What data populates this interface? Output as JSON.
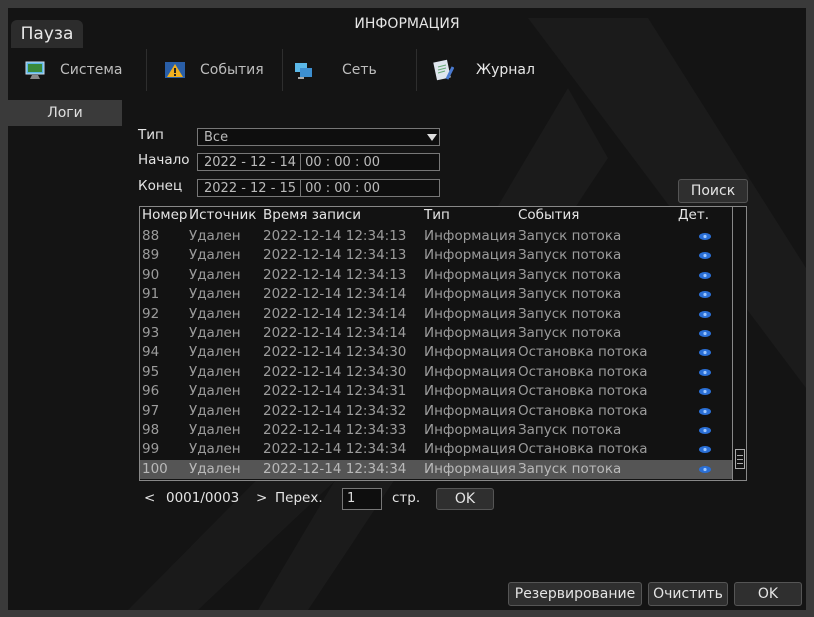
{
  "window": {
    "title": "ИНФОРМАЦИЯ",
    "pause_label": "Пауза"
  },
  "tabs": [
    {
      "label": "Система",
      "icon": "monitor-icon"
    },
    {
      "label": "События",
      "icon": "warning-icon"
    },
    {
      "label": "Сеть",
      "icon": "network-icon"
    },
    {
      "label": "Журнал",
      "icon": "log-icon"
    }
  ],
  "sidebar": {
    "items": [
      {
        "label": "Логи"
      }
    ]
  },
  "filters": {
    "type_label": "Тип",
    "type_value": "Все",
    "start_label": "Начало",
    "start_date": "2022  - 12 - 14",
    "start_time": "00 : 00 : 00",
    "end_label": "Конец",
    "end_date": "2022  - 12 - 15",
    "end_time": "00 : 00 : 00",
    "search_label": "Поиск"
  },
  "table": {
    "headers": {
      "num": "Номер",
      "source": "Источник",
      "time": "Время записи",
      "type": "Тип",
      "event": "События",
      "details": "Дет."
    },
    "rows": [
      {
        "num": "88",
        "source": "Удален",
        "time": "2022-12-14 12:34:13",
        "type": "Информация",
        "event": "Запуск потока"
      },
      {
        "num": "89",
        "source": "Удален",
        "time": "2022-12-14 12:34:13",
        "type": "Информация",
        "event": "Запуск потока"
      },
      {
        "num": "90",
        "source": "Удален",
        "time": "2022-12-14 12:34:13",
        "type": "Информация",
        "event": "Запуск потока"
      },
      {
        "num": "91",
        "source": "Удален",
        "time": "2022-12-14 12:34:14",
        "type": "Информация",
        "event": "Запуск потока"
      },
      {
        "num": "92",
        "source": "Удален",
        "time": "2022-12-14 12:34:14",
        "type": "Информация",
        "event": "Запуск потока"
      },
      {
        "num": "93",
        "source": "Удален",
        "time": "2022-12-14 12:34:14",
        "type": "Информация",
        "event": "Запуск потока"
      },
      {
        "num": "94",
        "source": "Удален",
        "time": "2022-12-14 12:34:30",
        "type": "Информация",
        "event": "Остановка потока"
      },
      {
        "num": "95",
        "source": "Удален",
        "time": "2022-12-14 12:34:30",
        "type": "Информация",
        "event": "Остановка потока"
      },
      {
        "num": "96",
        "source": "Удален",
        "time": "2022-12-14 12:34:31",
        "type": "Информация",
        "event": "Остановка потока"
      },
      {
        "num": "97",
        "source": "Удален",
        "time": "2022-12-14 12:34:32",
        "type": "Информация",
        "event": "Остановка потока"
      },
      {
        "num": "98",
        "source": "Удален",
        "time": "2022-12-14 12:34:33",
        "type": "Информация",
        "event": "Запуск потока"
      },
      {
        "num": "99",
        "source": "Удален",
        "time": "2022-12-14 12:34:34",
        "type": "Информация",
        "event": "Остановка потока"
      },
      {
        "num": "100",
        "source": "Удален",
        "time": "2022-12-14 12:34:34",
        "type": "Информация",
        "event": "Запуск потока"
      }
    ]
  },
  "pager": {
    "prev": "<",
    "page": "0001/0003",
    "next": ">",
    "goto_label": "Перех.",
    "goto_value": "1",
    "page_unit": "стр.",
    "ok_label": "OK"
  },
  "footer": {
    "backup_label": "Резервирование",
    "clear_label": "Очистить",
    "ok_label": "OK"
  },
  "colors": {
    "eye": "#2a6fd6",
    "selected_row": "#555555"
  }
}
